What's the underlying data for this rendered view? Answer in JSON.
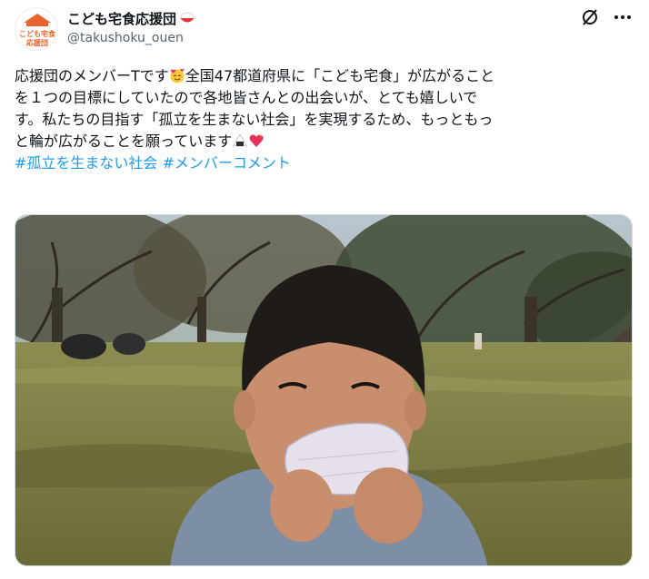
{
  "account": {
    "display_name": "こども宅食応援団",
    "handle": "@takushoku_ouen",
    "avatar_text_line1": "こども宅食",
    "avatar_text_line2": "応援団"
  },
  "header": {
    "grok_icon": "grok-icon",
    "more_icon": "more-icon"
  },
  "tweet": {
    "line1_a": "応援団のメンバーTです",
    "line1_b": "全国47都道府県に「こども宅食」が広がること",
    "line2": "を１つの目標にしていたので各地皆さんとの出会いが、とても嬉しいで",
    "line3": "す。私たちの目指す「孤立を生まない社会」を実現するため、もっともっ",
    "line4": "と輪が広がることを願っています",
    "hashtags": [
      "#孤立を生まない社会",
      "#メンバーコメント"
    ]
  },
  "colors": {
    "link": "#1d9bf0",
    "text": "#0f1419",
    "secondary": "#536471",
    "brand_orange": "#e8642c"
  }
}
